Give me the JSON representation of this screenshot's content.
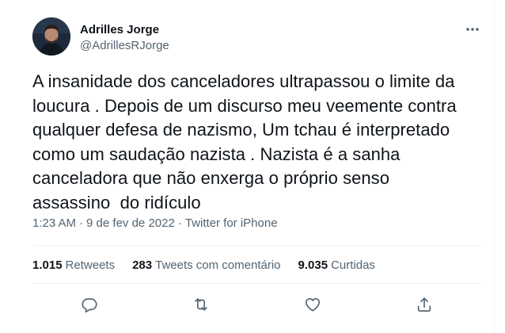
{
  "tweet": {
    "author": {
      "display_name": "Adrilles Jorge",
      "handle": "@AdrillesRJorge"
    },
    "text": "A insanidade dos canceladores ultrapassou o limite da\nloucura . Depois de um discurso meu veemente contra\nqualquer defesa de nazismo, Um tchau é interpretado\ncomo um saudação nazista . Nazista é a sanha\ncanceladora que não enxerga o próprio senso\nassassino  do ridículo",
    "time": "1:23 AM",
    "date": "9 de fev de 2022",
    "separator": "·",
    "source": "Twitter for iPhone",
    "stats": {
      "retweets": {
        "count": "1.015",
        "label": "Retweets"
      },
      "quote_tweets": {
        "count": "283",
        "label": "Tweets com comentário"
      },
      "likes": {
        "count": "9.035",
        "label": "Curtidas"
      }
    }
  },
  "icons": {
    "more": "more-horizontal-icon",
    "reply": "reply-icon",
    "retweet": "retweet-icon",
    "like": "heart-icon",
    "share": "share-icon"
  },
  "colors": {
    "text_primary": "#0f1419",
    "text_secondary": "#536471",
    "divider": "#eff3f4"
  }
}
